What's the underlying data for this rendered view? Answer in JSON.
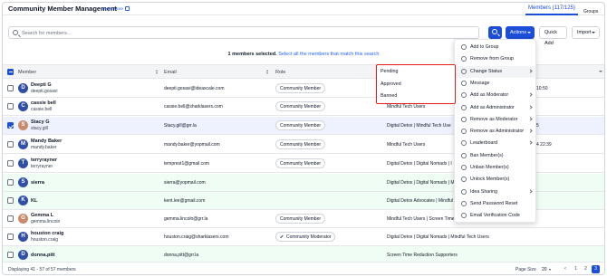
{
  "header": {
    "title": "Community Member Management",
    "learn_more": "Learn More",
    "tabs": [
      {
        "label": "Members (117/125)",
        "active": true
      },
      {
        "label": "Groups",
        "active": false
      }
    ]
  },
  "toolbar": {
    "search_placeholder": "Search for members...",
    "actions_label": "Actions",
    "quick_add_label": "Quick Add",
    "import_label": "Import"
  },
  "selection": {
    "count_text": "1 members selected.",
    "select_all_link": "Select all the members that match this search"
  },
  "table": {
    "columns": [
      "Member",
      "Email",
      "Role"
    ],
    "rows": [
      {
        "avatar": "D",
        "name": "Deepti G",
        "handle": "deepti.gosavi",
        "email": "deepti.gosavi@ideascale.com",
        "role": "Community Member",
        "groups": "",
        "extra": "10:50",
        "selected": false,
        "green": false
      },
      {
        "avatar": "C",
        "name": "cassie bell",
        "handle": "cassie.bell",
        "email": "cassie.bell@sharklasers.com",
        "role": "Community Member",
        "groups": "Mindful Tech Users",
        "extra": "",
        "selected": false,
        "green": false
      },
      {
        "avatar": "S",
        "name": "Stacy G",
        "handle": "stacy.gill",
        "email": "Stacy.gill@grr.la",
        "role": "Community Member",
        "groups": "Digital Detox | Mindful Tech Use",
        "extra": "5",
        "selected": true,
        "green": false
      },
      {
        "avatar": "M",
        "name": "Mandy Baker",
        "handle": "mandy.baker",
        "email": "mandy.baker@yopmail.com",
        "role": "Community Member",
        "groups": "Mindful Tech Users",
        "extra": "4 22:39",
        "selected": false,
        "green": false
      },
      {
        "avatar": "T",
        "name": "terryrayner",
        "handle": "terryrayner",
        "email": "temprest1@gmail.com",
        "role": "Community Member",
        "groups": "Digital Detox | Digital Nomads | I",
        "extra": "",
        "selected": false,
        "green": false
      },
      {
        "avatar": "S",
        "name": "sierra",
        "handle": "",
        "email": "sierra@yopmail.com",
        "role": "",
        "groups": "Digital Detox | Digital Nomads | Mindful Tech Users",
        "extra": "",
        "selected": false,
        "green": true
      },
      {
        "avatar": "K",
        "name": "KL",
        "handle": "",
        "email": "kent.lee@gmail.com",
        "role": "",
        "groups": "Digital Detox Advocates | Mindful Tech Users | Screen Time Redu...",
        "extra": "",
        "selected": false,
        "green": true
      },
      {
        "avatar": "G",
        "name": "Gemma L",
        "handle": "gemma.lincoln",
        "email": "gemma.lincoln@grr.la",
        "role": "Community Member",
        "groups": "Mindful Tech Users | Screen Time Reduction Supporters",
        "extra": "",
        "selected": false,
        "green": false
      },
      {
        "avatar": "H",
        "name": "houston craig",
        "handle": "houston.craig",
        "email": "houston.craig@sharklasers.com",
        "role": "Community Moderator",
        "groups": "Digital Detox | Digital Nomads | Mindful Tech Users",
        "extra": "",
        "selected": false,
        "green": false
      },
      {
        "avatar": "D",
        "name": "donna.pitt",
        "handle": "",
        "email": "donna.pitt@grr.la",
        "role": "",
        "groups": "Screen Time Reduction Supporters",
        "extra": "",
        "selected": false,
        "green": true
      }
    ]
  },
  "footer": {
    "displaying": "Displaying 41 - 57 of 57 members",
    "page_size_label": "Page Size",
    "page_size_value": "20",
    "pages": [
      "1",
      "2",
      "3"
    ],
    "current_page": "3"
  },
  "actions_menu": [
    {
      "label": "Add to Group",
      "icon": "user-plus-icon",
      "submenu": false
    },
    {
      "label": "Remove from Group",
      "icon": "user-minus-icon",
      "submenu": false
    },
    {
      "label": "Change Status",
      "icon": "status-icon",
      "submenu": true
    },
    {
      "label": "Message",
      "icon": "message-icon",
      "submenu": false
    },
    {
      "label": "Add as Moderator",
      "icon": "moderator-icon",
      "submenu": true
    },
    {
      "label": "Add as Administrator",
      "icon": "admin-icon",
      "submenu": true
    },
    {
      "label": "Remove as Moderator",
      "icon": "remove-moderator-icon",
      "submenu": true
    },
    {
      "label": "Remove as Administrator",
      "icon": "remove-admin-icon",
      "submenu": true
    },
    {
      "label": "Leaderboard",
      "icon": "leaderboard-icon",
      "submenu": true
    },
    {
      "label": "Ban Member(s)",
      "icon": "ban-icon",
      "submenu": false
    },
    {
      "label": "Unban Member(s)",
      "icon": "unban-icon",
      "submenu": false
    },
    {
      "label": "Unlock Member(s)",
      "icon": "unlock-icon",
      "submenu": false
    },
    {
      "label": "Idea Sharing",
      "icon": "idea-sharing-icon",
      "submenu": true
    },
    {
      "label": "Send Password Reset",
      "icon": "key-icon",
      "submenu": false
    },
    {
      "label": "Email Verification Code",
      "icon": "email-icon",
      "submenu": false
    }
  ],
  "status_submenu": [
    "Pending",
    "Approved",
    "Banned"
  ]
}
